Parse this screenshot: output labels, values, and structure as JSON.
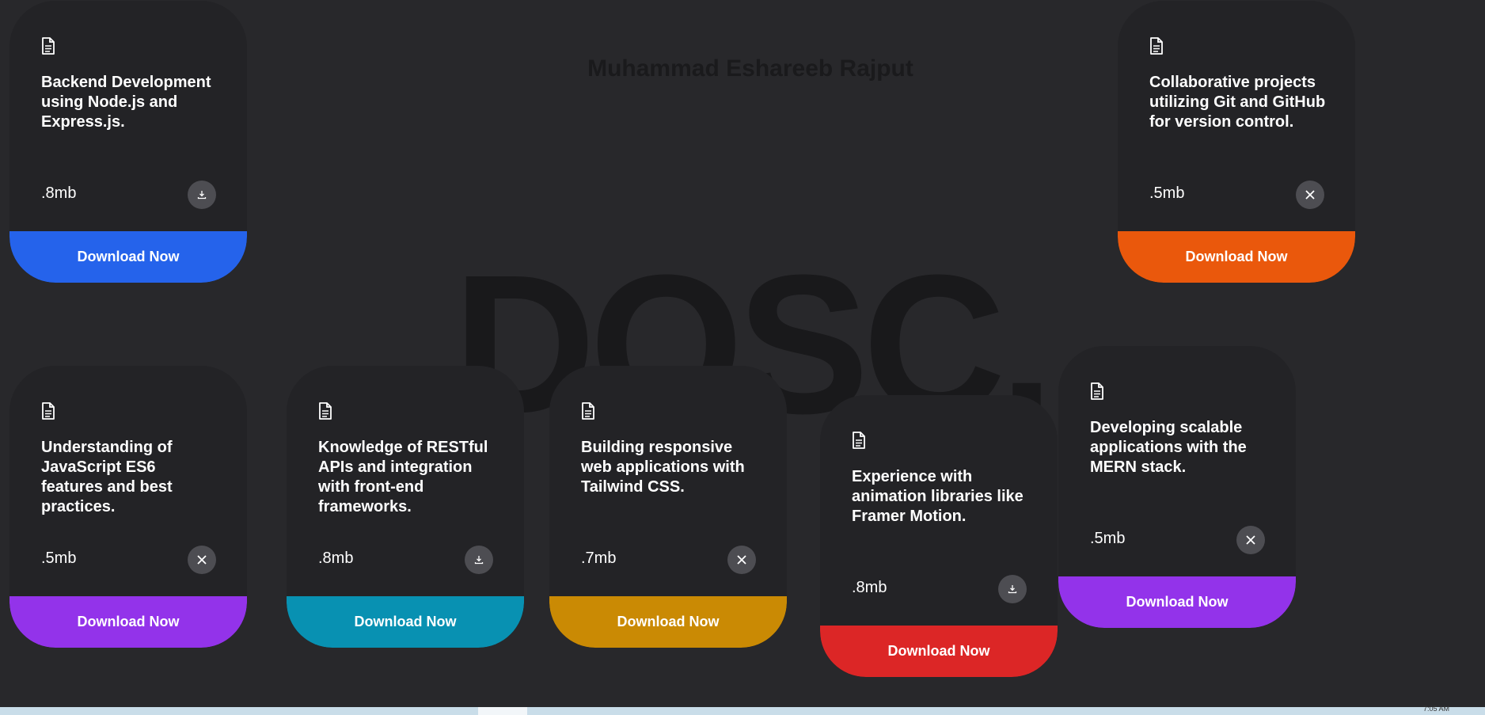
{
  "author": "Muhammad Eshareeb Rajput",
  "background_word": "DOSC.",
  "cards": [
    {
      "title": "Backend Development using Node.js and Express.js.",
      "size": ".8mb",
      "action": "download",
      "button": "Download Now",
      "accent": "#2563eb"
    },
    {
      "title": "Collaborative projects utilizing Git and GitHub for version control.",
      "size": ".5mb",
      "action": "close",
      "button": "Download Now",
      "accent": "#ea580c"
    },
    {
      "title": "Understanding of JavaScript ES6 features and best practices.",
      "size": ".5mb",
      "action": "close",
      "button": "Download Now",
      "accent": "#9333ea"
    },
    {
      "title": "Knowledge of RESTful APIs and integration with front-end frameworks.",
      "size": ".8mb",
      "action": "download",
      "button": "Download Now",
      "accent": "#0891b2"
    },
    {
      "title": "Building responsive web applications with Tailwind CSS.",
      "size": ".7mb",
      "action": "close",
      "button": "Download Now",
      "accent": "#ca8a04"
    },
    {
      "title": "Experience with animation libraries like Framer Motion.",
      "size": ".8mb",
      "action": "download",
      "button": "Download Now",
      "accent": "#dc2626"
    },
    {
      "title": "Developing scalable applications with the MERN stack.",
      "size": ".5mb",
      "action": "close",
      "button": "Download Now",
      "accent": "#9333ea"
    }
  ],
  "icons": {
    "file": "file-text-icon",
    "download": "download-icon",
    "close": "close-icon"
  },
  "taskbar": {
    "clock": "7:05 AM"
  }
}
